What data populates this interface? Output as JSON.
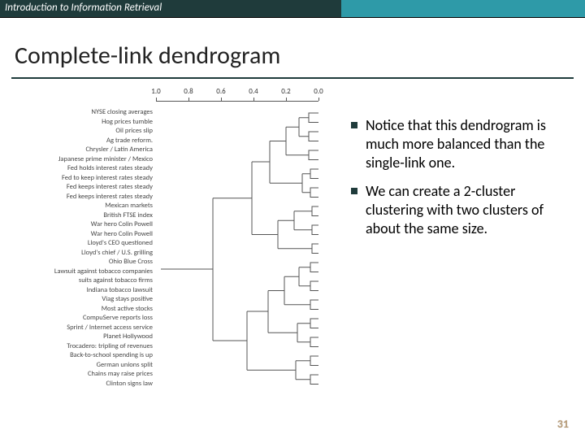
{
  "header": {
    "course": "Introduction to Information Retrieval"
  },
  "title": "Complete-link dendrogram",
  "bullets": [
    "Notice that this dendrogram is much more balanced than the single-link one.",
    "We can create a 2-cluster clustering with two clusters of about the same size."
  ],
  "page_number": "31",
  "chart_data": {
    "type": "dendrogram",
    "axis": {
      "ticks": [
        "1.0",
        "0.8",
        "0.6",
        "0.4",
        "0.2",
        "0.0"
      ],
      "range": [
        1.0,
        0.0
      ]
    },
    "leaves": [
      "NYSE closing averages",
      "Hog prices tumble",
      "Oil prices slip",
      "Ag trade reform.",
      "Chrysler / Latin America",
      "Japanese prime minister / Mexico",
      "Fed holds interest rates steady",
      "Fed to keep interest rates steady",
      "Fed keeps interest rates steady",
      "Fed keeps interest rates steady",
      "Mexican markets",
      "British FTSE index",
      "War hero Colin Powell",
      "War hero Colin Powell",
      "Lloyd's CEO questioned",
      "Lloyd's chief / U.S. grilling",
      "Ohio Blue Cross",
      "Lawsuit against tobacco companies",
      "suits against tobacco firms",
      "Indiana tobacco lawsuit",
      "Viag stays positive",
      "Most active stocks",
      "CompuServe reports loss",
      "Sprint / Internet access service",
      "Planet Hollywood",
      "Trocadero: tripling of revenues",
      "Back-to-school spending is up",
      "German unions split",
      "Chains may raise prices",
      "Clinton signs law"
    ]
  }
}
